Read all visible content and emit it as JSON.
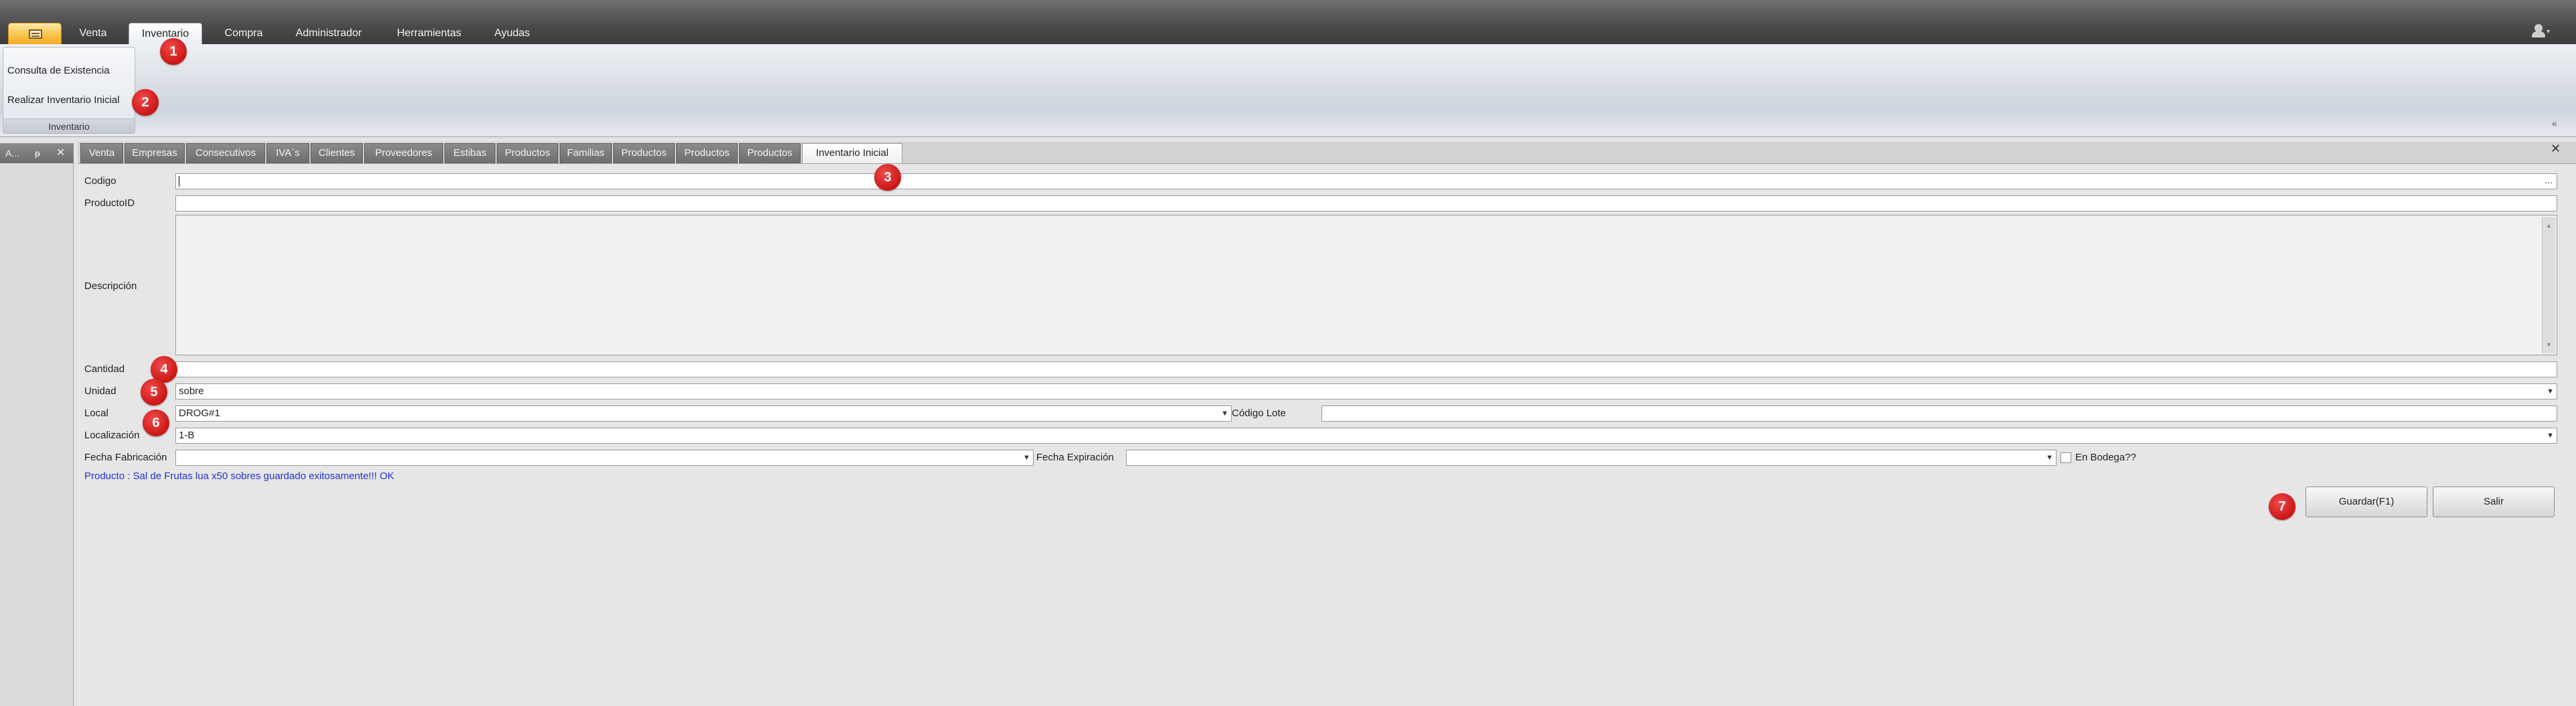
{
  "menubar": {
    "tabs": [
      "Venta",
      "Inventario",
      "Compra",
      "Administrador",
      "Herramientas",
      "Ayudas"
    ],
    "active_tab": "Inventario"
  },
  "ribbon": {
    "items": [
      "Consulta de Existencia",
      "Realizar Inventario Inicial"
    ],
    "group_label": "Inventario",
    "minimize_glyph": "«"
  },
  "dock": {
    "title": "A...",
    "pin": "ᵽ",
    "close": "✕"
  },
  "doc_tabs": {
    "labels": [
      "Venta",
      "Empresas",
      "Consecutivos",
      "IVA´s",
      "Clientes",
      "Proveedores",
      "Estibas",
      "Productos",
      "Familias",
      "Productos",
      "Productos",
      "Productos",
      "Inventario Inicial"
    ],
    "close": "✕"
  },
  "form": {
    "codigo_label": "Codigo",
    "codigo_value": "",
    "codigo_button": "...",
    "productoid_label": "ProductoID",
    "productoid_value": "",
    "descripcion_label": "Descripción",
    "descripcion_value": "",
    "cantidad_label": "Cantidad",
    "cantidad_value": "",
    "unidad_label": "Unidad",
    "unidad_value": "sobre",
    "local_label": "Local",
    "local_value": "DROG#1",
    "codigo_lote_label": "Código Lote",
    "codigo_lote_value": "",
    "localizacion_label": "Localización",
    "localizacion_value": "1-B",
    "fecha_fabricacion_label": "Fecha Fabricación",
    "fecha_fabricacion_value": "",
    "fecha_expiracion_label": "Fecha Expiración",
    "fecha_expiracion_value": "",
    "en_bodega_label": "En Bodega??",
    "en_bodega_checked": false,
    "status_message": "Producto : Sal de Frutas lua x50 sobres guardado exitosamente!!! OK",
    "guardar_label": "Guardar(F1)",
    "salir_label": "Salir"
  },
  "markers": [
    "1",
    "2",
    "3",
    "4",
    "5",
    "6",
    "7"
  ],
  "icons": {
    "app_button": "app-menu-icon",
    "user": "user-icon",
    "dropdown": "chevron-down-icon",
    "ellipsis": "ellipsis-icon"
  },
  "colors": {
    "marker_red": "#d61f1f",
    "status_text": "#2233cc",
    "app_button_orange": "#f9c449",
    "menubar_dark": "#4a4a4a"
  }
}
